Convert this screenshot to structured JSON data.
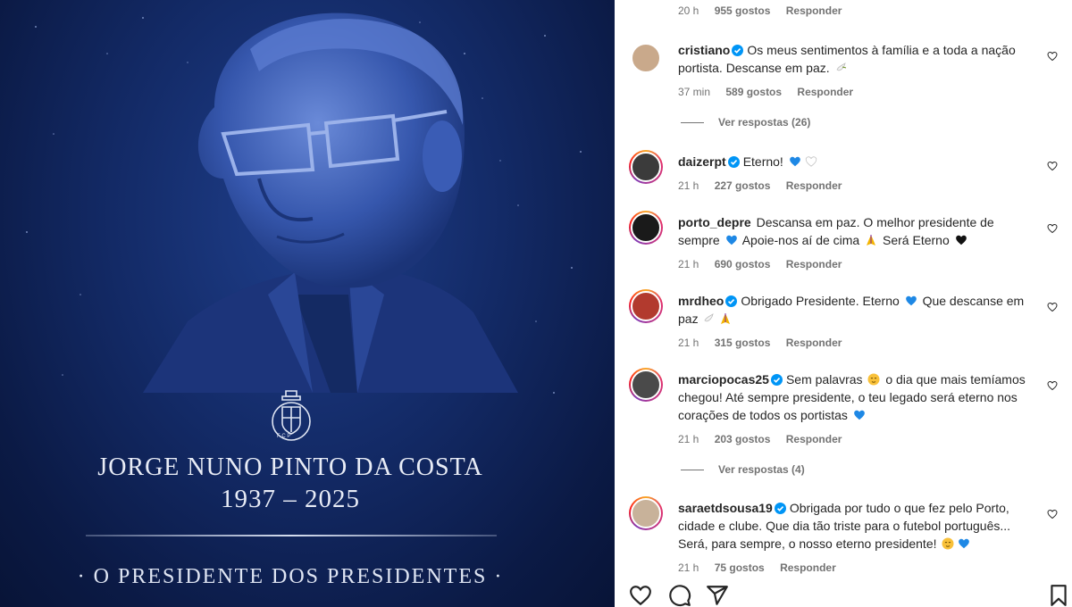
{
  "post": {
    "memorial_name": "JORGE NUNO PINTO DA COSTA",
    "memorial_years": "1937 – 2025",
    "memorial_tagline": "· O PRESIDENTE DOS PRESIDENTES ·"
  },
  "top_meta": {
    "time": "20 h",
    "likes": "955 gostos",
    "reply": "Responder"
  },
  "comments": [
    {
      "username": "cristiano",
      "verified": true,
      "text": "Os meus sentimentos à família e a toda a nação portista. Descanse em paz.",
      "emoji": [
        "dove"
      ],
      "time": "37 min",
      "likes": "589 gostos",
      "reply": "Responder",
      "avatar_color": "#c9a98b",
      "replies": "Ver respostas (26)"
    },
    {
      "username": "daizerpt",
      "verified": true,
      "text": "Eterno!",
      "emoji": [
        "blue-heart",
        "white-heart"
      ],
      "time": "21 h",
      "likes": "227 gostos",
      "reply": "Responder",
      "avatar_color": "#3b3b3b"
    },
    {
      "username": "porto_depre",
      "verified": false,
      "text": "Descansa em paz. O melhor presidente de sempre",
      "text2": "Apoie-nos aí de cima",
      "text3": "Será Eterno",
      "time": "21 h",
      "likes": "690 gostos",
      "reply": "Responder",
      "avatar_color": "#1a1a1a"
    },
    {
      "username": "mrdheo",
      "verified": true,
      "text": "Obrigado Presidente. Eterno",
      "text2": "Que descanse em paz",
      "time": "21 h",
      "likes": "315 gostos",
      "reply": "Responder",
      "avatar_color": "#b23a2e"
    },
    {
      "username": "marciopocas25",
      "verified": true,
      "text": "Sem palavras",
      "text2": "o dia que mais temíamos chegou! Até sempre presidente, o teu legado será eterno nos corações de todos os portistas",
      "time": "21 h",
      "likes": "203 gostos",
      "reply": "Responder",
      "avatar_color": "#4a4a4a",
      "replies": "Ver respostas (4)"
    },
    {
      "username": "saraetdsousa19",
      "verified": true,
      "text": "Obrigada por tudo o que fez pelo Porto, cidade e clube. Que dia tão triste para o futebol português... Será, para sempre, o nosso eterno presidente!",
      "time": "21 h",
      "likes": "75 gostos",
      "reply": "Responder",
      "avatar_color": "#c8b29a"
    }
  ],
  "actions": [
    "heart-icon",
    "comment-icon",
    "share-icon",
    "bookmark-icon"
  ],
  "colors": {
    "verified": "#0095f6",
    "blue_heart": "#1e88e5",
    "text": "#262626",
    "meta": "#737373"
  }
}
